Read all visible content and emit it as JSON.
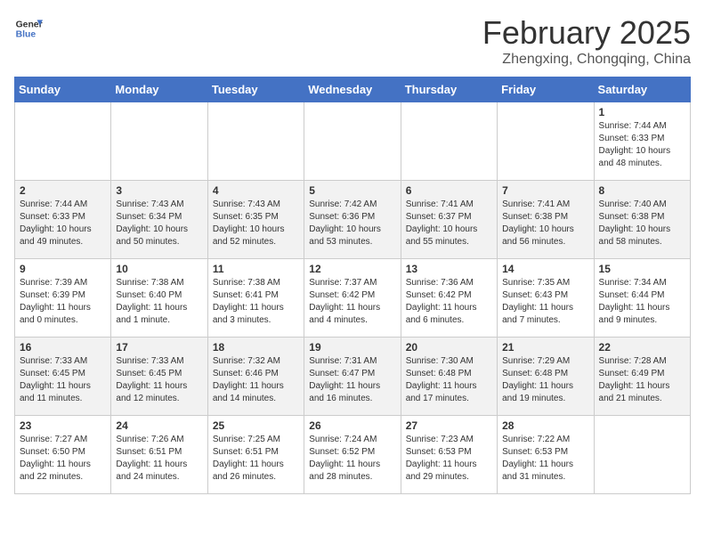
{
  "header": {
    "logo_general": "General",
    "logo_blue": "Blue",
    "month_title": "February 2025",
    "location": "Zhengxing, Chongqing, China"
  },
  "weekdays": [
    "Sunday",
    "Monday",
    "Tuesday",
    "Wednesday",
    "Thursday",
    "Friday",
    "Saturday"
  ],
  "weeks": [
    [
      {
        "day": "",
        "info": ""
      },
      {
        "day": "",
        "info": ""
      },
      {
        "day": "",
        "info": ""
      },
      {
        "day": "",
        "info": ""
      },
      {
        "day": "",
        "info": ""
      },
      {
        "day": "",
        "info": ""
      },
      {
        "day": "1",
        "info": "Sunrise: 7:44 AM\nSunset: 6:33 PM\nDaylight: 10 hours\nand 48 minutes."
      }
    ],
    [
      {
        "day": "2",
        "info": "Sunrise: 7:44 AM\nSunset: 6:33 PM\nDaylight: 10 hours\nand 49 minutes."
      },
      {
        "day": "3",
        "info": "Sunrise: 7:43 AM\nSunset: 6:34 PM\nDaylight: 10 hours\nand 50 minutes."
      },
      {
        "day": "4",
        "info": "Sunrise: 7:43 AM\nSunset: 6:35 PM\nDaylight: 10 hours\nand 52 minutes."
      },
      {
        "day": "5",
        "info": "Sunrise: 7:42 AM\nSunset: 6:36 PM\nDaylight: 10 hours\nand 53 minutes."
      },
      {
        "day": "6",
        "info": "Sunrise: 7:41 AM\nSunset: 6:37 PM\nDaylight: 10 hours\nand 55 minutes."
      },
      {
        "day": "7",
        "info": "Sunrise: 7:41 AM\nSunset: 6:38 PM\nDaylight: 10 hours\nand 56 minutes."
      },
      {
        "day": "8",
        "info": "Sunrise: 7:40 AM\nSunset: 6:38 PM\nDaylight: 10 hours\nand 58 minutes."
      }
    ],
    [
      {
        "day": "9",
        "info": "Sunrise: 7:39 AM\nSunset: 6:39 PM\nDaylight: 11 hours\nand 0 minutes."
      },
      {
        "day": "10",
        "info": "Sunrise: 7:38 AM\nSunset: 6:40 PM\nDaylight: 11 hours\nand 1 minute."
      },
      {
        "day": "11",
        "info": "Sunrise: 7:38 AM\nSunset: 6:41 PM\nDaylight: 11 hours\nand 3 minutes."
      },
      {
        "day": "12",
        "info": "Sunrise: 7:37 AM\nSunset: 6:42 PM\nDaylight: 11 hours\nand 4 minutes."
      },
      {
        "day": "13",
        "info": "Sunrise: 7:36 AM\nSunset: 6:42 PM\nDaylight: 11 hours\nand 6 minutes."
      },
      {
        "day": "14",
        "info": "Sunrise: 7:35 AM\nSunset: 6:43 PM\nDaylight: 11 hours\nand 7 minutes."
      },
      {
        "day": "15",
        "info": "Sunrise: 7:34 AM\nSunset: 6:44 PM\nDaylight: 11 hours\nand 9 minutes."
      }
    ],
    [
      {
        "day": "16",
        "info": "Sunrise: 7:33 AM\nSunset: 6:45 PM\nDaylight: 11 hours\nand 11 minutes."
      },
      {
        "day": "17",
        "info": "Sunrise: 7:33 AM\nSunset: 6:45 PM\nDaylight: 11 hours\nand 12 minutes."
      },
      {
        "day": "18",
        "info": "Sunrise: 7:32 AM\nSunset: 6:46 PM\nDaylight: 11 hours\nand 14 minutes."
      },
      {
        "day": "19",
        "info": "Sunrise: 7:31 AM\nSunset: 6:47 PM\nDaylight: 11 hours\nand 16 minutes."
      },
      {
        "day": "20",
        "info": "Sunrise: 7:30 AM\nSunset: 6:48 PM\nDaylight: 11 hours\nand 17 minutes."
      },
      {
        "day": "21",
        "info": "Sunrise: 7:29 AM\nSunset: 6:48 PM\nDaylight: 11 hours\nand 19 minutes."
      },
      {
        "day": "22",
        "info": "Sunrise: 7:28 AM\nSunset: 6:49 PM\nDaylight: 11 hours\nand 21 minutes."
      }
    ],
    [
      {
        "day": "23",
        "info": "Sunrise: 7:27 AM\nSunset: 6:50 PM\nDaylight: 11 hours\nand 22 minutes."
      },
      {
        "day": "24",
        "info": "Sunrise: 7:26 AM\nSunset: 6:51 PM\nDaylight: 11 hours\nand 24 minutes."
      },
      {
        "day": "25",
        "info": "Sunrise: 7:25 AM\nSunset: 6:51 PM\nDaylight: 11 hours\nand 26 minutes."
      },
      {
        "day": "26",
        "info": "Sunrise: 7:24 AM\nSunset: 6:52 PM\nDaylight: 11 hours\nand 28 minutes."
      },
      {
        "day": "27",
        "info": "Sunrise: 7:23 AM\nSunset: 6:53 PM\nDaylight: 11 hours\nand 29 minutes."
      },
      {
        "day": "28",
        "info": "Sunrise: 7:22 AM\nSunset: 6:53 PM\nDaylight: 11 hours\nand 31 minutes."
      },
      {
        "day": "",
        "info": ""
      }
    ]
  ]
}
